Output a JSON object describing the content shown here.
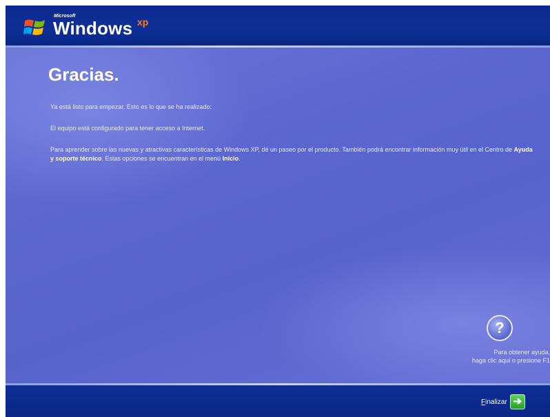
{
  "header": {
    "microsoft_label": "Microsoft",
    "windows_label": "Windows",
    "xp_label": "xp"
  },
  "content": {
    "title": "Gracias.",
    "line1": "Ya está listo para empezar. Esto es lo que se ha realizado:",
    "line2": "El equipo está configurado para tener acceso a Internet.",
    "line3_part1": "Para aprender sobre las nuevas y atractivas características de Windows XP, dé un paseo por el producto. También podrá encontrar información muy útil en el Centro de ",
    "line3_bold1": "Ayuda y soporte técnico",
    "line3_part2": ". Estas opciones se encuentran en el menú ",
    "line3_bold2": "Inicio",
    "line3_part3": "."
  },
  "help": {
    "icon_glyph": "?",
    "text_line1": "Para obtener ayuda,",
    "text_line2": "haga clic aquí o presione F1"
  },
  "footer": {
    "finish_underlined": "F",
    "finish_rest": "inalizar",
    "arrow_glyph": "➔"
  },
  "colors": {
    "header_blue": "#0d2f98",
    "content_blue": "#5b66cf",
    "xp_orange": "#ff7a1a",
    "button_green": "#27a12a"
  }
}
